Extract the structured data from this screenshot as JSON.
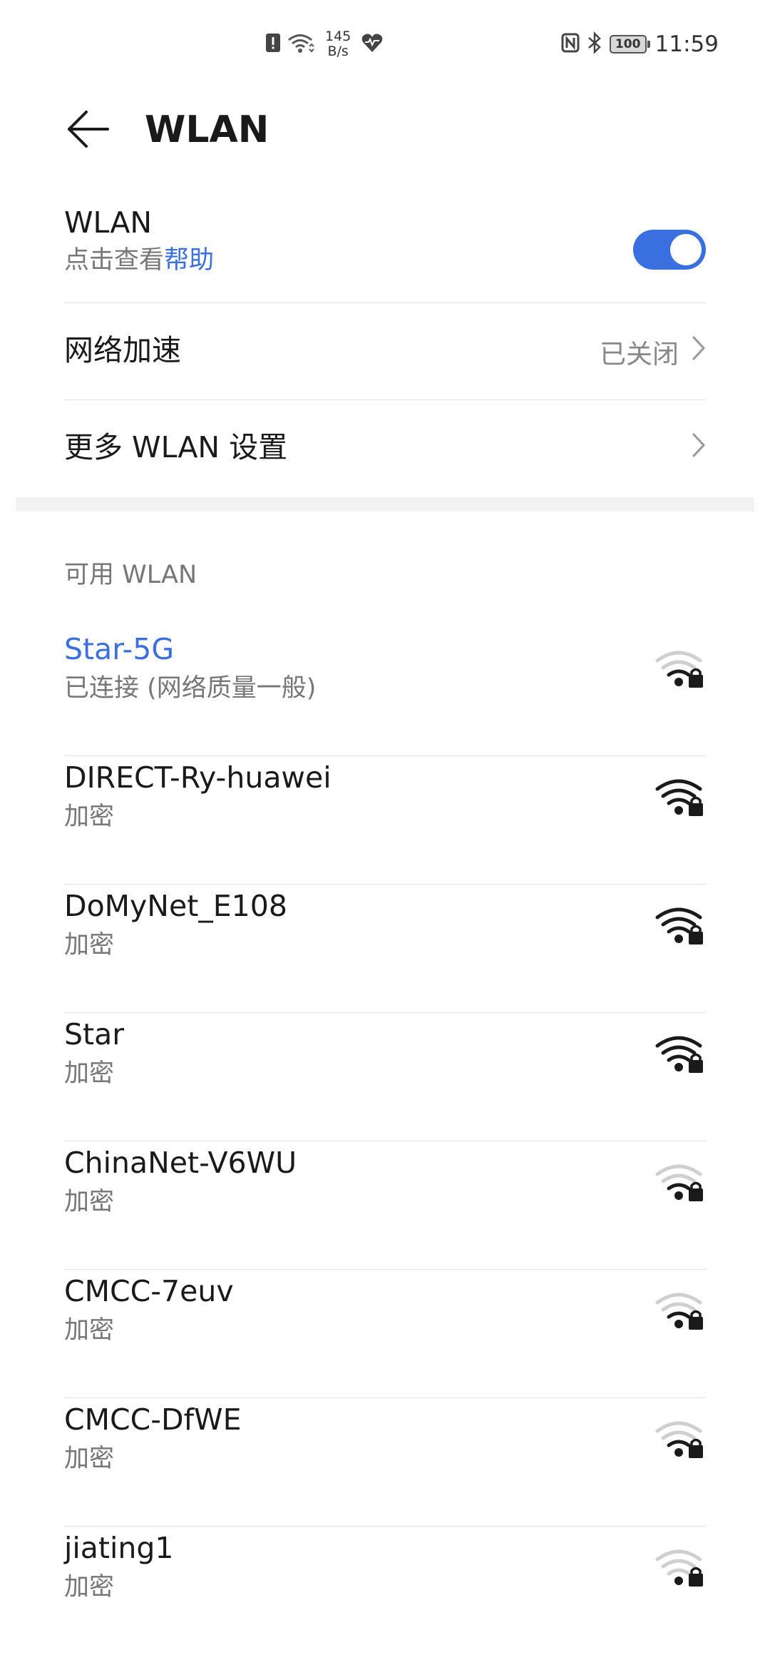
{
  "status_bar": {
    "rate_value": "145",
    "rate_unit": "B/s",
    "battery": "100",
    "time": "11:59"
  },
  "header": {
    "title": "WLAN"
  },
  "wlan_toggle": {
    "title": "WLAN",
    "sub_prefix": "点击查看",
    "sub_link": "帮助",
    "enabled": true,
    "accent_color": "#3a6fe0"
  },
  "network_acceleration": {
    "title": "网络加速",
    "value": "已关闭"
  },
  "more_settings": {
    "title": "更多 WLAN 设置"
  },
  "available": {
    "header": "可用 WLAN",
    "networks": [
      {
        "name": "Star-5G",
        "status": "已连接 (网络质量一般)",
        "connected": true,
        "signal": 2
      },
      {
        "name": "DIRECT-Ry-huawei",
        "status": "加密",
        "connected": false,
        "signal": 4
      },
      {
        "name": "DoMyNet_E108",
        "status": "加密",
        "connected": false,
        "signal": 4
      },
      {
        "name": "Star",
        "status": "加密",
        "connected": false,
        "signal": 4
      },
      {
        "name": "ChinaNet-V6WU",
        "status": "加密",
        "connected": false,
        "signal": 2
      },
      {
        "name": "CMCC-7euv",
        "status": "加密",
        "connected": false,
        "signal": 2
      },
      {
        "name": "CMCC-DfWE",
        "status": "加密",
        "connected": false,
        "signal": 2
      },
      {
        "name": "jiating1",
        "status": "加密",
        "connected": false,
        "signal": 1
      }
    ]
  }
}
